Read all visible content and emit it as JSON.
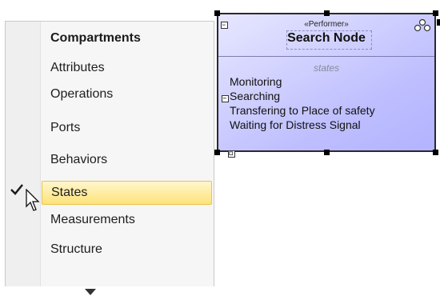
{
  "menu": {
    "header": "Compartments",
    "items": [
      {
        "label": "Attributes",
        "checked": false,
        "highlighted": false
      },
      {
        "label": "Operations",
        "checked": false,
        "highlighted": false
      },
      {
        "label": "Ports",
        "checked": false,
        "highlighted": false
      },
      {
        "label": "Behaviors",
        "checked": false,
        "highlighted": false
      },
      {
        "label": "States",
        "checked": true,
        "highlighted": true
      },
      {
        "label": "Measurements",
        "checked": false,
        "highlighted": false
      },
      {
        "label": "Structure",
        "checked": false,
        "highlighted": false
      }
    ],
    "more_icon": "triangle-down-icon",
    "check_icon": "checkmark-icon",
    "highlight_color": "#fde37a"
  },
  "node": {
    "stereotype": "«Performer»",
    "name": "Search Node",
    "compartment_title": "states",
    "states": [
      "Monitoring",
      "Searching",
      "Transfering to Place of safety",
      "Waiting for Distress Signal"
    ],
    "fill_color": "#bdbdff",
    "stereotype_icon": "performer-icon"
  }
}
